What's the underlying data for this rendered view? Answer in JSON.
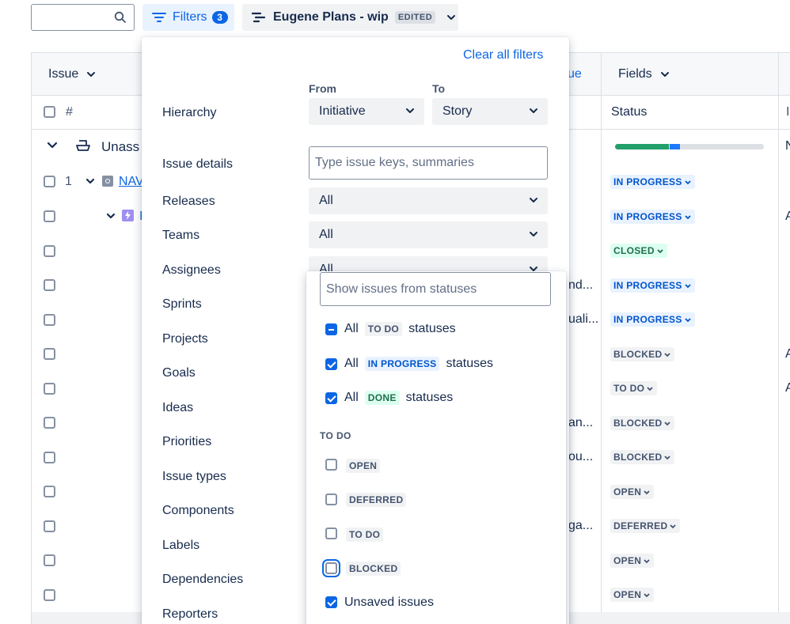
{
  "toolbar": {
    "filters_label": "Filters",
    "filters_count": "3",
    "plan_name": "Eugene Plans - wip",
    "plan_badge": "EDITED"
  },
  "table": {
    "col_issue": "Issue",
    "col_hash": "#",
    "col_partial_value": "ue",
    "col_fields": "Fields",
    "col_status": "Status",
    "col_partial_right": "I",
    "group_label": "Unass",
    "row1_number": "1",
    "row1_key": "NAV",
    "row2_key": "I",
    "right_initials": [
      "N",
      "A",
      "A",
      "A"
    ],
    "truncated_cells": [
      "nd...",
      "uali...",
      "an...",
      "ou...",
      "ga..."
    ],
    "progress": {
      "done": 0.36,
      "in_progress": 0.07
    },
    "statuses": [
      "IN PROGRESS",
      "IN PROGRESS",
      "CLOSED",
      "IN PROGRESS",
      "IN PROGRESS",
      "BLOCKED",
      "TO DO",
      "BLOCKED",
      "BLOCKED",
      "OPEN",
      "DEFERRED",
      "OPEN",
      "OPEN"
    ]
  },
  "panel": {
    "clear_all": "Clear all filters",
    "from_label": "From",
    "to_label": "To",
    "hierarchy_label": "Hierarchy",
    "hierarchy_from": "Initiative",
    "hierarchy_to": "Story",
    "issue_details_label": "Issue details",
    "issue_details_placeholder": "Type issue keys, summaries",
    "releases_label": "Releases",
    "releases_value": "All",
    "teams_label": "Teams",
    "teams_value": "All",
    "assignees_label": "Assignees",
    "assignees_value": "All",
    "labels": [
      "Sprints",
      "Projects",
      "Goals",
      "Ideas",
      "Priorities",
      "Issue types",
      "Components",
      "Labels",
      "Dependencies",
      "Reporters"
    ]
  },
  "status_dropdown": {
    "search_placeholder": "Show issues from statuses",
    "all_word": "All",
    "statuses_word": "statuses",
    "todo_category": "TO DO",
    "inprogress_category": "IN PROGRESS",
    "done_category": "DONE",
    "section_todo": "TO DO",
    "todo_items": [
      "OPEN",
      "DEFERRED",
      "TO DO",
      "BLOCKED"
    ],
    "unsaved_label": "Unsaved issues"
  }
}
